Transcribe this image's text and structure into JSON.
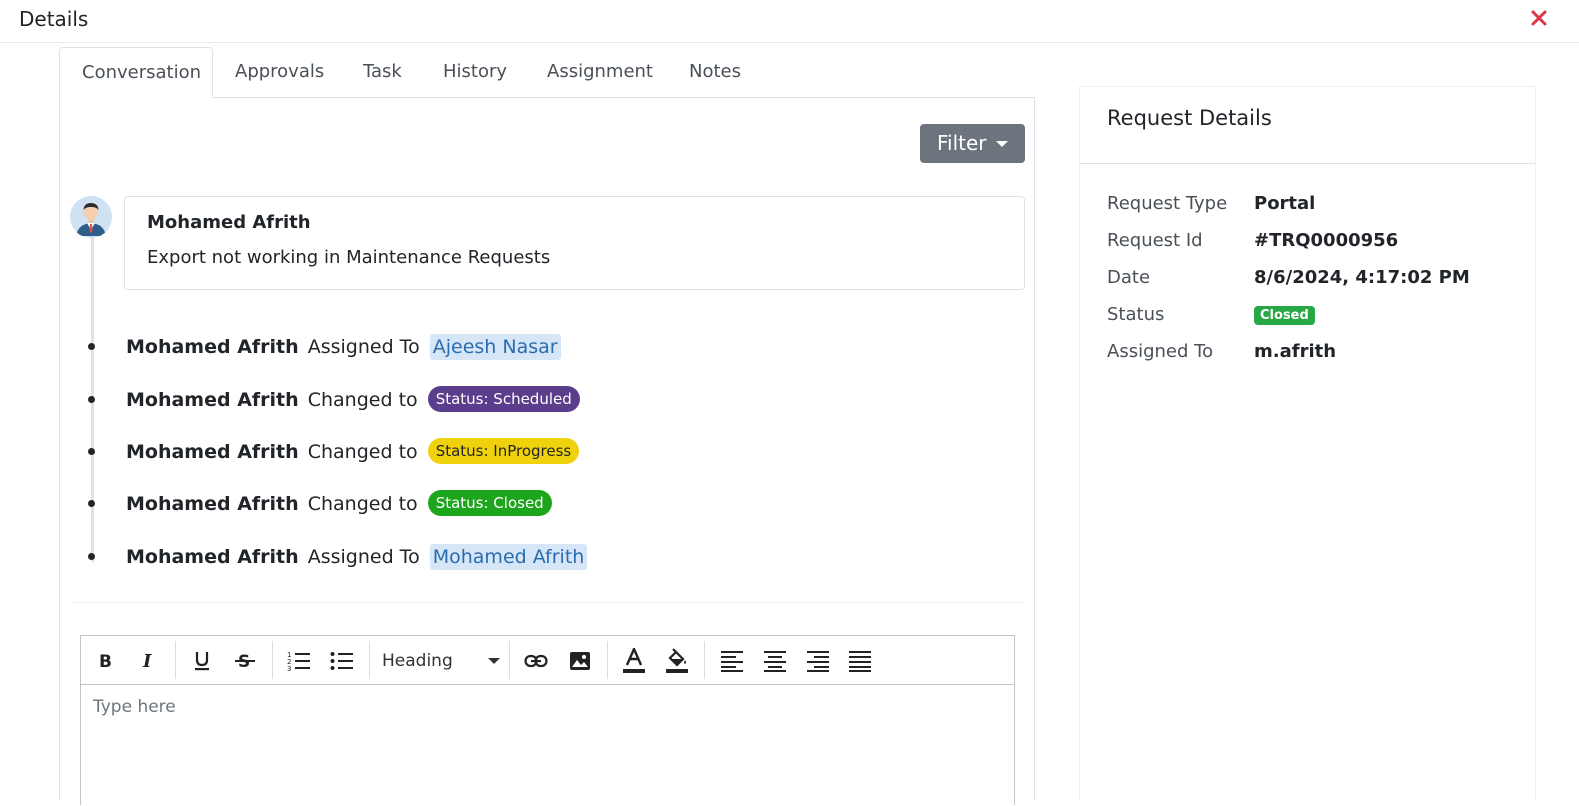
{
  "header": {
    "title": "Details",
    "close_icon": "close-icon",
    "close_color": "#dc3545"
  },
  "tabs": [
    {
      "label": "Conversation",
      "active": true
    },
    {
      "label": "Approvals"
    },
    {
      "label": "Task"
    },
    {
      "label": "History"
    },
    {
      "label": "Assignment"
    },
    {
      "label": "Notes"
    }
  ],
  "conversation": {
    "filter_label": "Filter",
    "message": {
      "author": "Mohamed Afrith",
      "text": "Export not working in Maintenance Requests"
    },
    "events": [
      {
        "who": "Mohamed Afrith",
        "action": "Assigned To",
        "target": "Ajeesh Nasar",
        "kind": "user"
      },
      {
        "who": "Mohamed Afrith",
        "action": "Changed to",
        "target": "Status: Scheduled",
        "kind": "status",
        "color": "#5a3e8c",
        "text_color": "#ffffff"
      },
      {
        "who": "Mohamed Afrith",
        "action": "Changed to",
        "target": "Status: InProgress",
        "kind": "status",
        "color": "#f0d20c",
        "text_color": "#212529"
      },
      {
        "who": "Mohamed Afrith",
        "action": "Changed to",
        "target": "Status: Closed",
        "kind": "status",
        "color": "#1ea51e",
        "text_color": "#ffffff"
      },
      {
        "who": "Mohamed Afrith",
        "action": "Assigned To",
        "target": "Mohamed Afrith",
        "kind": "user"
      }
    ]
  },
  "editor": {
    "heading_label": "Heading",
    "placeholder": "Type here",
    "tools": [
      "bold-icon",
      "italic-icon",
      "underline-icon",
      "strikethrough-icon",
      "numbered-list-icon",
      "bulleted-list-icon",
      "link-icon",
      "image-icon",
      "font-color-icon",
      "background-color-icon",
      "align-left-icon",
      "align-center-icon",
      "align-right-icon",
      "align-justify-icon"
    ]
  },
  "request_details": {
    "title": "Request Details",
    "rows": [
      {
        "label": "Request Type",
        "value": "Portal"
      },
      {
        "label": "Request Id",
        "value": "#TRQ0000956"
      },
      {
        "label": "Date",
        "value": "8/6/2024, 4:17:02 PM"
      },
      {
        "label": "Status",
        "value": "Closed",
        "badge_color": "#28a745"
      },
      {
        "label": "Assigned To",
        "value": "m.afrith"
      }
    ]
  }
}
